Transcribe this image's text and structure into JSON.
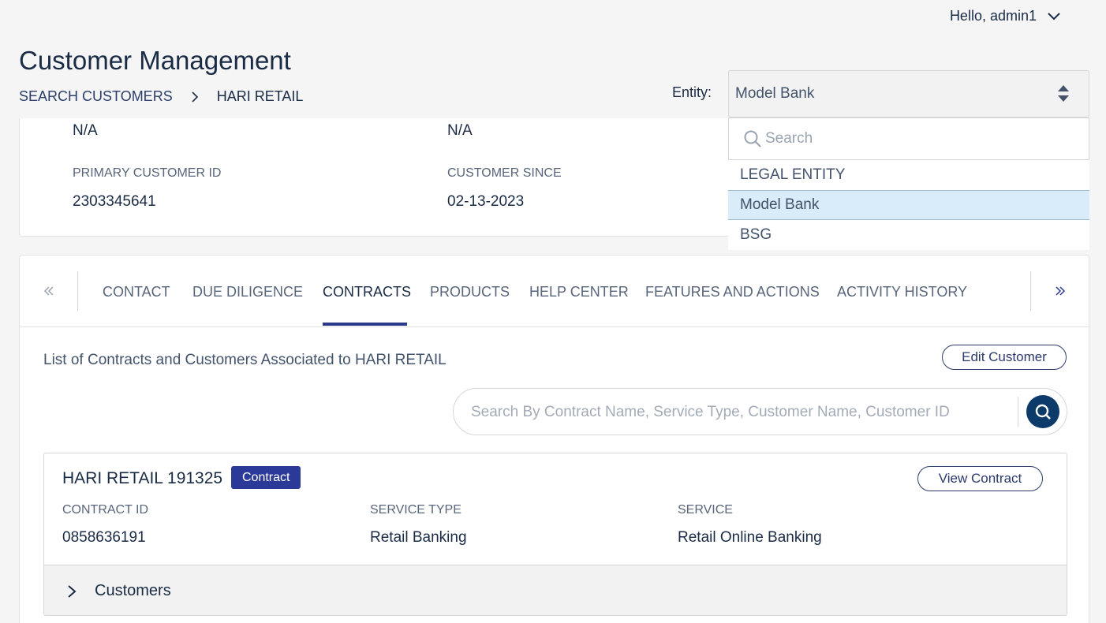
{
  "header": {
    "greeting": "Hello, admin1",
    "page_title": "Customer Management",
    "breadcrumb": {
      "parent": "SEARCH CUSTOMERS",
      "current": "HARI RETAIL"
    },
    "entity_label": "Entity:",
    "entity_selected": "Model Bank"
  },
  "entity_dropdown": {
    "search_placeholder": "Search",
    "items": [
      "LEGAL ENTITY",
      "Model Bank",
      "BSG"
    ],
    "selected_index": 1
  },
  "customer_info": {
    "row1": {
      "col1_value": "N/A",
      "col2_value": "N/A"
    },
    "primary_customer_id_label": "PRIMARY CUSTOMER ID",
    "primary_customer_id": "2303345641",
    "customer_since_label": "CUSTOMER SINCE",
    "customer_since": "02-13-2023"
  },
  "tabs": {
    "items": [
      "CONTACT",
      "DUE DILIGENCE",
      "CONTRACTS",
      "PRODUCTS",
      "HELP CENTER",
      "FEATURES AND ACTIONS",
      "ACTIVITY HISTORY"
    ],
    "active": "CONTRACTS"
  },
  "contracts": {
    "list_title": "List of Contracts and Customers Associated to HARI RETAIL",
    "edit_button": "Edit Customer",
    "search_placeholder": "Search By Contract Name, Service Type, Customer Name, Customer ID",
    "card": {
      "title": "HARI RETAIL 191325",
      "badge": "Contract",
      "view_button": "View Contract",
      "contract_id_label": "CONTRACT ID",
      "contract_id": "0858636191",
      "service_type_label": "SERVICE TYPE",
      "service_type": "Retail Banking",
      "service_label": "SERVICE",
      "service": "Retail Online Banking",
      "customers_label": "Customers"
    }
  },
  "colors": {
    "primary_navy": "#192b45",
    "accent_blue": "#2b3a98",
    "search_button": "#0c3a69",
    "selected_bg": "#d8ecf9"
  }
}
